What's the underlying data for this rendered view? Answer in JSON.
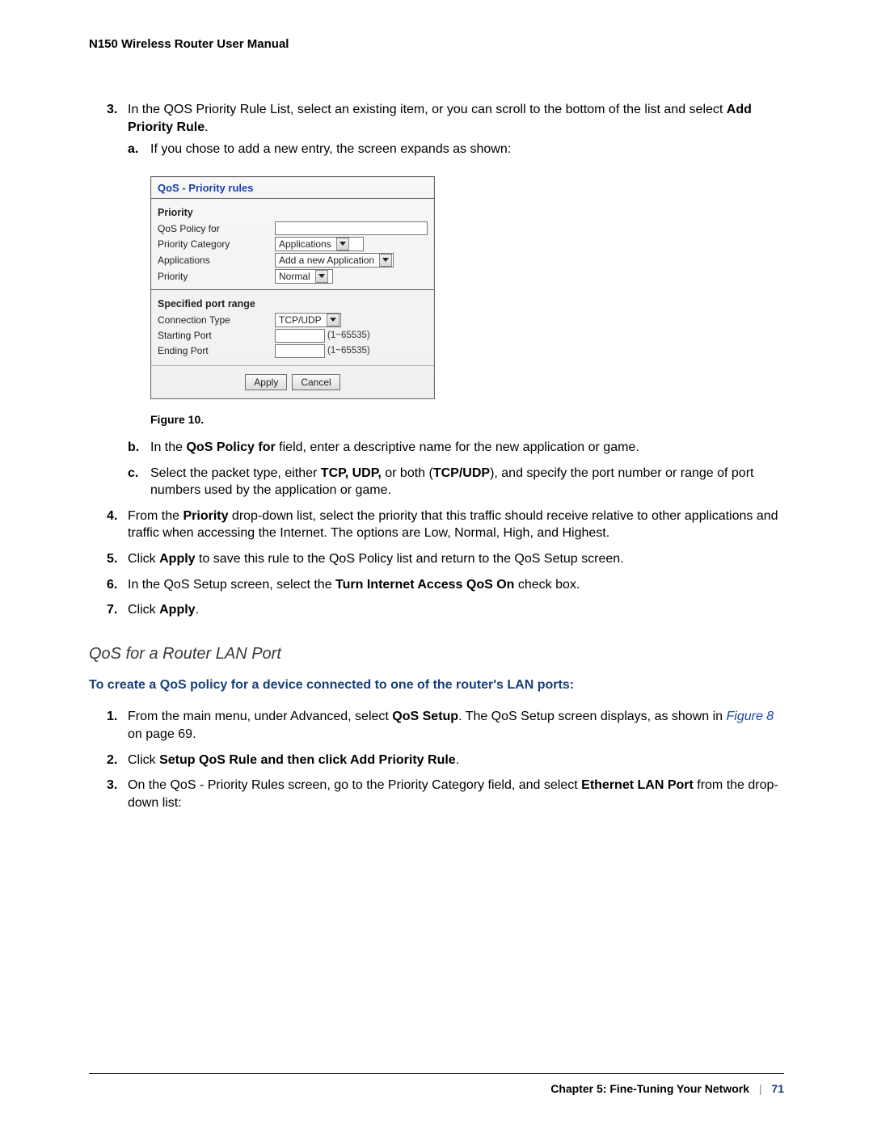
{
  "header": {
    "title": "N150 Wireless Router User Manual"
  },
  "step3": {
    "num": "3.",
    "text_a": "In the QOS Priority Rule List, select an existing item, or you can scroll to the bottom of the list and select ",
    "bold_a": "Add Priority Rule",
    "text_b": ".",
    "sub_a": {
      "letter": "a.",
      "text": "If you chose to add a new entry, the screen expands as shown:"
    }
  },
  "figure": {
    "panel_title": "QoS - Priority rules",
    "sec1_title": "Priority",
    "rows": {
      "qos_policy_for": "QoS Policy for",
      "priority_category": "Priority Category",
      "applications_label": "Applications",
      "priority_label": "Priority",
      "priority_category_value": "Applications",
      "applications_value": "Add a new Application",
      "priority_value": "Normal"
    },
    "sec2_title": "Specified port range",
    "rows2": {
      "connection_type": "Connection Type",
      "connection_type_value": "TCP/UDP",
      "starting_port": "Starting Port",
      "ending_port": "Ending Port",
      "port_hint": "(1~65535)"
    },
    "apply": "Apply",
    "cancel": "Cancel",
    "caption": "Figure 10."
  },
  "step3b": {
    "letter": "b.",
    "t1": "In the ",
    "b1": "QoS Policy for",
    "t2": " field, enter a descriptive name for the new application or game."
  },
  "step3c": {
    "letter": "c.",
    "t1": "Select the packet type, either ",
    "b1": "TCP, UDP,",
    "t2": " or both (",
    "b2": "TCP/UDP",
    "t3": "), and specify the port number or range of port numbers used by the application or game."
  },
  "step4": {
    "num": "4.",
    "t1": "From the ",
    "b1": "Priority",
    "t2": " drop-down list, select the priority that this traffic should receive relative to other applications and traffic when accessing the Internet. The options are Low, Normal, High, and Highest."
  },
  "step5": {
    "num": "5.",
    "t1": "Click ",
    "b1": "Apply",
    "t2": " to save this rule to the QoS Policy list and return to the QoS Setup screen."
  },
  "step6": {
    "num": "6.",
    "t1": "In the QoS Setup screen, select the ",
    "b1": "Turn Internet Access QoS On",
    "t2": " check box."
  },
  "step7": {
    "num": "7.",
    "t1": "Click ",
    "b1": "Apply",
    "t2": "."
  },
  "lan": {
    "heading": "QoS for a Router LAN Port",
    "subheading": "To create a QoS policy for a device connected to one of the router's LAN ports:",
    "s1": {
      "num": "1.",
      "t1": "From the main menu, under Advanced, select ",
      "b1": "QoS Setup",
      "t2": ". The QoS Setup screen displays, as shown in ",
      "link": "Figure 8",
      "t3": " on page 69."
    },
    "s2": {
      "num": "2.",
      "t1": "Click ",
      "b1": "Setup QoS Rule and then click Add Priority Rule",
      "t2": "."
    },
    "s3": {
      "num": "3.",
      "t1": "On the QoS - Priority Rules screen, go to the Priority Category field, and select ",
      "b1": "Ethernet LAN Port",
      "t2": " from the drop-down list:"
    }
  },
  "footer": {
    "chapter": "Chapter 5:  Fine-Tuning Your Network",
    "sep": "|",
    "page": "71"
  }
}
